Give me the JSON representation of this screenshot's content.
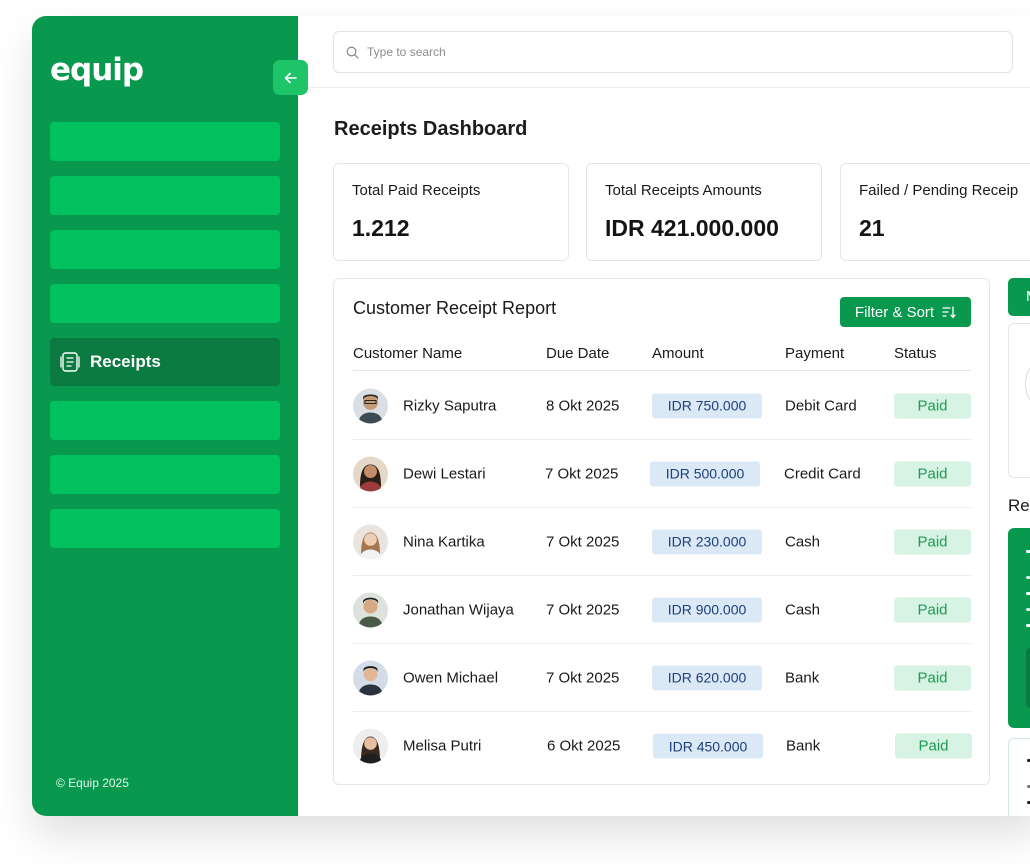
{
  "app": {
    "brand": "equip",
    "copyright": "© Equip 2025"
  },
  "sidebar": {
    "active_item": "Receipts",
    "active_icon": "receipt-icon"
  },
  "search": {
    "placeholder": "Type to search"
  },
  "page": {
    "title": "Receipts Dashboard"
  },
  "stats": [
    {
      "label": "Total Paid Receipts",
      "value": "1.212"
    },
    {
      "label": "Total Receipts Amounts",
      "value": "IDR 421.000.000"
    },
    {
      "label": "Failed / Pending Receip",
      "value": "21"
    }
  ],
  "report": {
    "title": "Customer Receipt Report",
    "filter_label": "Filter & Sort",
    "columns": [
      "Customer Name",
      "Due Date",
      "Amount",
      "Payment",
      "Status"
    ],
    "rows": [
      {
        "name": "Rizky Saputra",
        "date": "8 Okt 2025",
        "amount": "IDR 750.000",
        "payment": "Debit Card",
        "status": "Paid"
      },
      {
        "name": "Dewi Lestari",
        "date": "7 Okt 2025",
        "amount": "IDR 500.000",
        "payment": "Credit Card",
        "status": "Paid"
      },
      {
        "name": "Nina Kartika",
        "date": "7 Okt 2025",
        "amount": "IDR 230.000",
        "payment": "Cash",
        "status": "Paid"
      },
      {
        "name": "Jonathan Wijaya",
        "date": "7 Okt 2025",
        "amount": "IDR 900.000",
        "payment": "Cash",
        "status": "Paid"
      },
      {
        "name": "Owen Michael",
        "date": "7 Okt 2025",
        "amount": "IDR 620.000",
        "payment": "Bank",
        "status": "Paid"
      },
      {
        "name": "Melisa Putri",
        "date": "6 Okt 2025",
        "amount": "IDR 450.000",
        "payment": "Bank",
        "status": "Paid"
      }
    ]
  },
  "right_panel": {
    "button_label": "M",
    "section_title": "Re"
  },
  "colors": {
    "brand_green": "#08994e",
    "nav_item": "#00c15e",
    "nav_active": "#0b7a40",
    "amount_bg": "#dbe9f7",
    "status_bg": "#d7f3e3"
  }
}
